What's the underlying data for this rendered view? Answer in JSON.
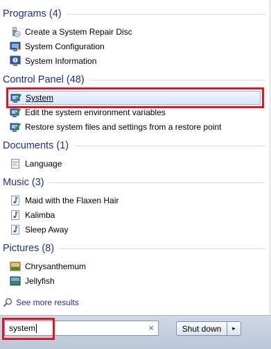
{
  "groups": [
    {
      "title": "Programs (4)",
      "items": [
        {
          "label": "Create a System Repair Disc",
          "icon": "repair-disc-icon"
        },
        {
          "label": "System Configuration",
          "icon": "system-configuration-icon"
        },
        {
          "label": "System Information",
          "icon": "system-information-icon"
        }
      ]
    },
    {
      "title": "Control Panel (48)",
      "items": [
        {
          "label": "System",
          "icon": "control-panel-system-icon",
          "selected": true
        },
        {
          "label": "Edit the system environment variables",
          "icon": "control-panel-system-icon"
        },
        {
          "label": "Restore system files and settings from a restore point",
          "icon": "control-panel-system-icon"
        }
      ]
    },
    {
      "title": "Documents (1)",
      "items": [
        {
          "label": "Language",
          "icon": "document-icon"
        }
      ]
    },
    {
      "title": "Music (3)",
      "items": [
        {
          "label": "Maid with the Flaxen Hair",
          "icon": "music-note-icon"
        },
        {
          "label": "Kalimba",
          "icon": "music-note-icon"
        },
        {
          "label": "Sleep Away",
          "icon": "music-note-icon"
        }
      ]
    },
    {
      "title": "Pictures (8)",
      "items": [
        {
          "label": "Chrysanthemum",
          "icon": "picture-icon"
        },
        {
          "label": "Jellyfish",
          "icon": "picture-icon"
        }
      ]
    }
  ],
  "see_more": {
    "label": "See more results",
    "icon": "magnifier-icon"
  },
  "search": {
    "value": "system",
    "clear": "×"
  },
  "shutdown": {
    "label": "Shut down",
    "arrow": "▸"
  },
  "colors": {
    "group_header": "#1e3287",
    "highlight_box": "#e1151f",
    "selection": "#d9e8fb"
  }
}
